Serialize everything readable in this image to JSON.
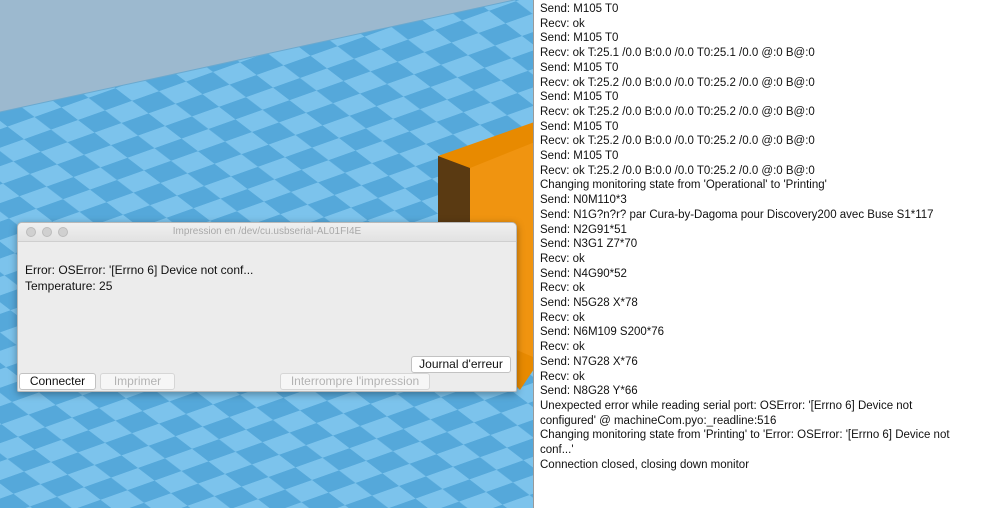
{
  "print_dialog": {
    "title": "Impression en /dev/cu.usbserial-AL01FI4E",
    "error_text": "Error: OSError: '[Errno 6] Device not conf...",
    "temperature_text": "Temperature: 25",
    "buttons": {
      "error_log": "Journal d'erreur",
      "connect": "Connecter",
      "print": "Imprimer",
      "cancel_print": "Interrompre l'impression"
    }
  },
  "log": {
    "lines": [
      "Send: M105 T0",
      "Recv: ok",
      "Send: M105 T0",
      "Recv: ok T:25.1 /0.0 B:0.0 /0.0 T0:25.1 /0.0 @:0 B@:0",
      "Send: M105 T0",
      "Recv: ok T:25.2 /0.0 B:0.0 /0.0 T0:25.2 /0.0 @:0 B@:0",
      "Send: M105 T0",
      "Recv: ok T:25.2 /0.0 B:0.0 /0.0 T0:25.2 /0.0 @:0 B@:0",
      "Send: M105 T0",
      "Recv: ok T:25.2 /0.0 B:0.0 /0.0 T0:25.2 /0.0 @:0 B@:0",
      "Send: M105 T0",
      "Recv: ok T:25.2 /0.0 B:0.0 /0.0 T0:25.2 /0.0 @:0 B@:0",
      "Changing monitoring state from 'Operational' to 'Printing'",
      "Send: N0M110*3",
      "Send: N1G?n?r? par Cura-by-Dagoma pour Discovery200 avec Buse S1*117",
      "Send: N2G91*51",
      "Send: N3G1 Z7*70",
      "Recv: ok",
      "Send: N4G90*52",
      "Recv: ok",
      "Send: N5G28 X*78",
      "Recv: ok",
      "Send: N6M109 S200*76",
      "Recv: ok",
      "Send: N7G28 X*76",
      "Recv: ok",
      "Send: N8G28 Y*66",
      "Unexpected error while reading serial port: OSError: '[Errno 6] Device not",
      "configured' @ machineCom.pyo:_readline:516",
      "Changing monitoring state from 'Printing' to 'Error: OSError: '[Errno 6] Device not",
      "conf...'",
      "Connection closed, closing down monitor"
    ]
  },
  "colors": {
    "bed_light": "#7ec4ec",
    "bed_dark": "#52a5d8",
    "sky": "#9cb9cf",
    "object_front": "#e88a00",
    "object_side": "#5a3a12"
  }
}
